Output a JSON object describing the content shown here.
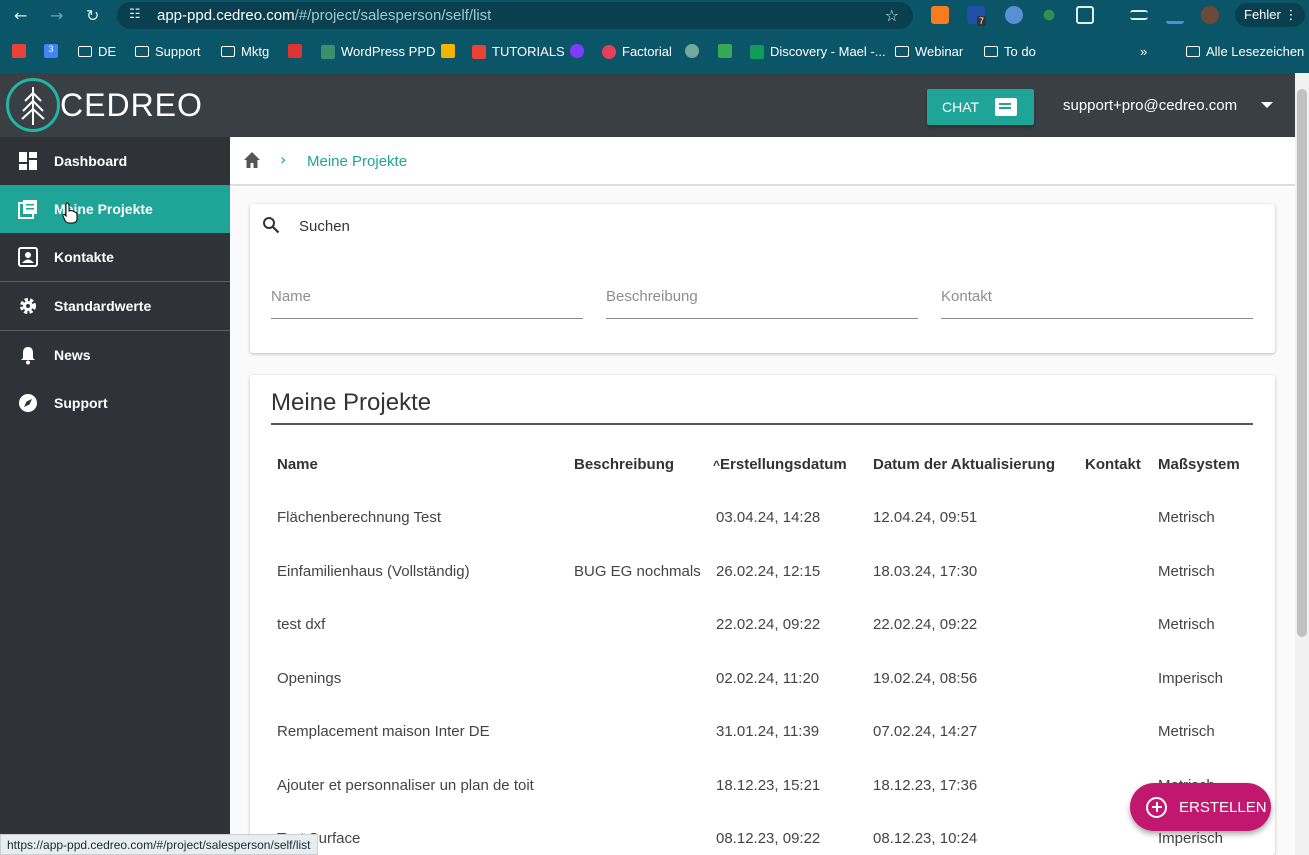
{
  "browser": {
    "url_host": "app-ppd.cedreo.com",
    "url_path": "/#/project/salesperson/self/list",
    "profile_button": "Fehler",
    "bookmarks": [
      "DE",
      "Support",
      "Mktg",
      "WordPress PPD",
      "TUTORIALS",
      "Factorial",
      "Discovery - Mael -...",
      "Webinar",
      "To do"
    ],
    "all_bookmarks": "Alle Lesezeichen",
    "more_bookmarks": "»",
    "calendar_badge": "3",
    "ext_badge": "7"
  },
  "header": {
    "logo_text": "CEDREO",
    "chat_label": "CHAT",
    "user_email": "support+pro@cedreo.com"
  },
  "sidebar": {
    "items": [
      {
        "label": "Dashboard",
        "icon": "dashboard-icon"
      },
      {
        "label": "Meine Projekte",
        "icon": "projects-icon",
        "active": true
      },
      {
        "label": "Kontakte",
        "icon": "contacts-icon"
      },
      {
        "label": "Standardwerte",
        "icon": "gear-icon"
      },
      {
        "label": "News",
        "icon": "bell-icon"
      },
      {
        "label": "Support",
        "icon": "compass-icon"
      }
    ]
  },
  "breadcrumb": {
    "current": "Meine Projekte"
  },
  "search": {
    "label": "Suchen",
    "name_placeholder": "Name",
    "description_placeholder": "Beschreibung",
    "contact_placeholder": "Kontakt"
  },
  "projects": {
    "title": "Meine Projekte",
    "columns": {
      "name": "Name",
      "description": "Beschreibung",
      "created": "Erstellungsdatum",
      "updated": "Datum der Aktualisierung",
      "contact": "Kontakt",
      "units": "Maßsystem"
    },
    "sort_indicator": "^",
    "rows": [
      {
        "name": "Flächenberechnung Test",
        "description": "",
        "created": "03.04.24, 14:28",
        "updated": "12.04.24, 09:51",
        "contact": "",
        "units": "Metrisch"
      },
      {
        "name": "Einfamilienhaus (Vollständig)",
        "description": "BUG EG nochmals",
        "created": "26.02.24, 12:15",
        "updated": "18.03.24, 17:30",
        "contact": "",
        "units": "Metrisch"
      },
      {
        "name": "test dxf",
        "description": "",
        "created": "22.02.24, 09:22",
        "updated": "22.02.24, 09:22",
        "contact": "",
        "units": "Metrisch"
      },
      {
        "name": "Openings",
        "description": "",
        "created": "02.02.24, 11:20",
        "updated": "19.02.24, 08:56",
        "contact": "",
        "units": "Imperisch"
      },
      {
        "name": "Remplacement maison Inter DE",
        "description": "",
        "created": "31.01.24, 11:39",
        "updated": "07.02.24, 14:27",
        "contact": "",
        "units": "Metrisch"
      },
      {
        "name": "Ajouter et personnaliser un plan de toit",
        "description": "",
        "created": "18.12.23, 15:21",
        "updated": "18.12.23, 17:36",
        "contact": "",
        "units": "Metrisch"
      },
      {
        "name": "Test Surface",
        "description": "",
        "created": "08.12.23, 09:22",
        "updated": "08.12.23, 10:24",
        "contact": "",
        "units": "Imperisch"
      }
    ]
  },
  "fab": {
    "label": "ERSTELLEN"
  },
  "status_url": "https://app-ppd.cedreo.com/#/project/salesperson/self/list",
  "colors": {
    "accent": "#1fa498",
    "fab": "#c2176f",
    "sidebar": "#2f3338",
    "header": "#3a3f44",
    "chrome": "#0b5568"
  }
}
